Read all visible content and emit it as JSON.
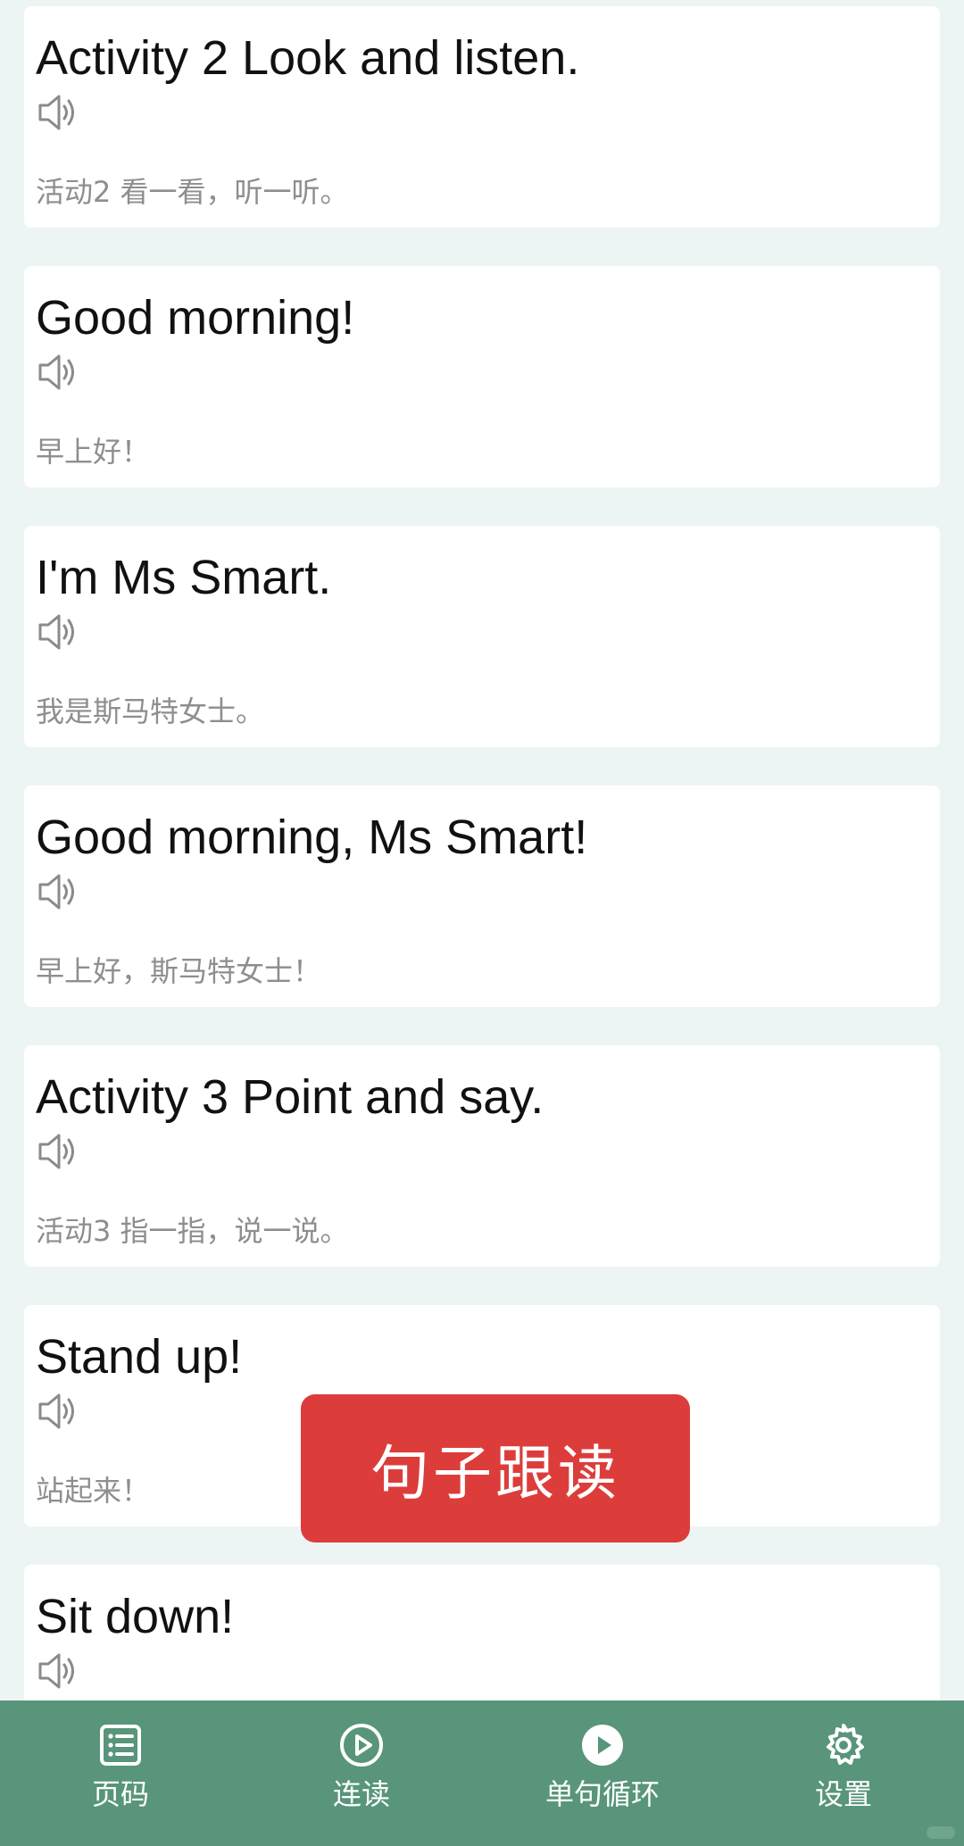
{
  "sentences": [
    {
      "en": "Activity 2 Look and listen.",
      "zh": "活动2 看一看，听一听。"
    },
    {
      "en": "Good morning!",
      "zh": "早上好！"
    },
    {
      "en": "I'm Ms Smart.",
      "zh": "我是斯马特女士。"
    },
    {
      "en": "Good morning, Ms Smart!",
      "zh": "早上好，斯马特女士！"
    },
    {
      "en": "Activity 3 Point and say.",
      "zh": "活动3 指一指，说一说。"
    },
    {
      "en": "Stand up!",
      "zh": "站起来！"
    },
    {
      "en": "Sit down!",
      "zh": ""
    }
  ],
  "toast": {
    "label": "句子跟读"
  },
  "nav": [
    {
      "label": "页码",
      "icon": "list-icon"
    },
    {
      "label": "连读",
      "icon": "play-outline-icon"
    },
    {
      "label": "单句循环",
      "icon": "play-filled-icon"
    },
    {
      "label": "设置",
      "icon": "gear-icon"
    }
  ],
  "colors": {
    "background": "#edf5f4",
    "card": "#ffffff",
    "bottom_bar": "#58957a",
    "toast": "#dc3d3b",
    "english_text": "#111111",
    "chinese_text": "#8e8e8e"
  }
}
